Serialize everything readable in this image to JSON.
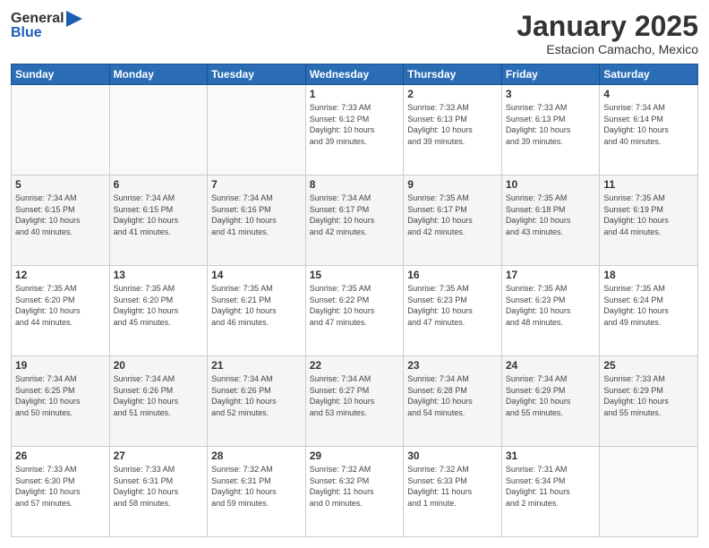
{
  "header": {
    "logo_general": "General",
    "logo_blue": "Blue",
    "month": "January 2025",
    "location": "Estacion Camacho, Mexico"
  },
  "days_of_week": [
    "Sunday",
    "Monday",
    "Tuesday",
    "Wednesday",
    "Thursday",
    "Friday",
    "Saturday"
  ],
  "weeks": [
    [
      {
        "day": "",
        "info": ""
      },
      {
        "day": "",
        "info": ""
      },
      {
        "day": "",
        "info": ""
      },
      {
        "day": "1",
        "info": "Sunrise: 7:33 AM\nSunset: 6:12 PM\nDaylight: 10 hours\nand 39 minutes."
      },
      {
        "day": "2",
        "info": "Sunrise: 7:33 AM\nSunset: 6:13 PM\nDaylight: 10 hours\nand 39 minutes."
      },
      {
        "day": "3",
        "info": "Sunrise: 7:33 AM\nSunset: 6:13 PM\nDaylight: 10 hours\nand 39 minutes."
      },
      {
        "day": "4",
        "info": "Sunrise: 7:34 AM\nSunset: 6:14 PM\nDaylight: 10 hours\nand 40 minutes."
      }
    ],
    [
      {
        "day": "5",
        "info": "Sunrise: 7:34 AM\nSunset: 6:15 PM\nDaylight: 10 hours\nand 40 minutes."
      },
      {
        "day": "6",
        "info": "Sunrise: 7:34 AM\nSunset: 6:15 PM\nDaylight: 10 hours\nand 41 minutes."
      },
      {
        "day": "7",
        "info": "Sunrise: 7:34 AM\nSunset: 6:16 PM\nDaylight: 10 hours\nand 41 minutes."
      },
      {
        "day": "8",
        "info": "Sunrise: 7:34 AM\nSunset: 6:17 PM\nDaylight: 10 hours\nand 42 minutes."
      },
      {
        "day": "9",
        "info": "Sunrise: 7:35 AM\nSunset: 6:17 PM\nDaylight: 10 hours\nand 42 minutes."
      },
      {
        "day": "10",
        "info": "Sunrise: 7:35 AM\nSunset: 6:18 PM\nDaylight: 10 hours\nand 43 minutes."
      },
      {
        "day": "11",
        "info": "Sunrise: 7:35 AM\nSunset: 6:19 PM\nDaylight: 10 hours\nand 44 minutes."
      }
    ],
    [
      {
        "day": "12",
        "info": "Sunrise: 7:35 AM\nSunset: 6:20 PM\nDaylight: 10 hours\nand 44 minutes."
      },
      {
        "day": "13",
        "info": "Sunrise: 7:35 AM\nSunset: 6:20 PM\nDaylight: 10 hours\nand 45 minutes."
      },
      {
        "day": "14",
        "info": "Sunrise: 7:35 AM\nSunset: 6:21 PM\nDaylight: 10 hours\nand 46 minutes."
      },
      {
        "day": "15",
        "info": "Sunrise: 7:35 AM\nSunset: 6:22 PM\nDaylight: 10 hours\nand 47 minutes."
      },
      {
        "day": "16",
        "info": "Sunrise: 7:35 AM\nSunset: 6:23 PM\nDaylight: 10 hours\nand 47 minutes."
      },
      {
        "day": "17",
        "info": "Sunrise: 7:35 AM\nSunset: 6:23 PM\nDaylight: 10 hours\nand 48 minutes."
      },
      {
        "day": "18",
        "info": "Sunrise: 7:35 AM\nSunset: 6:24 PM\nDaylight: 10 hours\nand 49 minutes."
      }
    ],
    [
      {
        "day": "19",
        "info": "Sunrise: 7:34 AM\nSunset: 6:25 PM\nDaylight: 10 hours\nand 50 minutes."
      },
      {
        "day": "20",
        "info": "Sunrise: 7:34 AM\nSunset: 6:26 PM\nDaylight: 10 hours\nand 51 minutes."
      },
      {
        "day": "21",
        "info": "Sunrise: 7:34 AM\nSunset: 6:26 PM\nDaylight: 10 hours\nand 52 minutes."
      },
      {
        "day": "22",
        "info": "Sunrise: 7:34 AM\nSunset: 6:27 PM\nDaylight: 10 hours\nand 53 minutes."
      },
      {
        "day": "23",
        "info": "Sunrise: 7:34 AM\nSunset: 6:28 PM\nDaylight: 10 hours\nand 54 minutes."
      },
      {
        "day": "24",
        "info": "Sunrise: 7:34 AM\nSunset: 6:29 PM\nDaylight: 10 hours\nand 55 minutes."
      },
      {
        "day": "25",
        "info": "Sunrise: 7:33 AM\nSunset: 6:29 PM\nDaylight: 10 hours\nand 55 minutes."
      }
    ],
    [
      {
        "day": "26",
        "info": "Sunrise: 7:33 AM\nSunset: 6:30 PM\nDaylight: 10 hours\nand 57 minutes."
      },
      {
        "day": "27",
        "info": "Sunrise: 7:33 AM\nSunset: 6:31 PM\nDaylight: 10 hours\nand 58 minutes."
      },
      {
        "day": "28",
        "info": "Sunrise: 7:32 AM\nSunset: 6:31 PM\nDaylight: 10 hours\nand 59 minutes."
      },
      {
        "day": "29",
        "info": "Sunrise: 7:32 AM\nSunset: 6:32 PM\nDaylight: 11 hours\nand 0 minutes."
      },
      {
        "day": "30",
        "info": "Sunrise: 7:32 AM\nSunset: 6:33 PM\nDaylight: 11 hours\nand 1 minute."
      },
      {
        "day": "31",
        "info": "Sunrise: 7:31 AM\nSunset: 6:34 PM\nDaylight: 11 hours\nand 2 minutes."
      },
      {
        "day": "",
        "info": ""
      }
    ]
  ]
}
